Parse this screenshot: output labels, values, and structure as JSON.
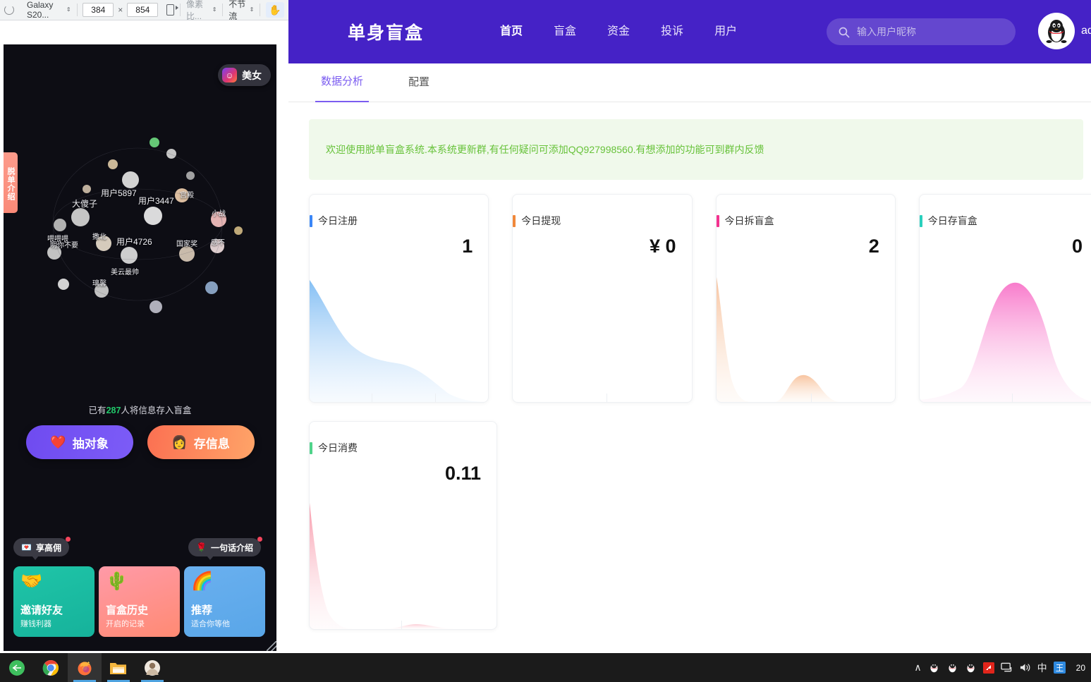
{
  "devtools": {
    "device_name": "Galaxy S20...",
    "width": "384",
    "height": "854",
    "rotate_icon": "rotate-icon",
    "dpr_label": "像素比...",
    "throttle_label": "不节流",
    "x_label": "×",
    "hand_icon": "touch-hand-icon"
  },
  "phone": {
    "badge_button": "美女",
    "badge_icon": "smiley-gradient-icon",
    "side_tab": "脱单介绍",
    "count_prefix": "已有",
    "count_number": "287",
    "count_suffix": "人将信息存入盲盒",
    "cta": [
      {
        "label": "抽对象",
        "emoji": "❤️",
        "color": "#7050f2"
      },
      {
        "label": "存信息",
        "emoji": "👩",
        "color": "#fb7d5b"
      }
    ],
    "tips": [
      {
        "label": "享高佣",
        "emoji": "💌"
      },
      {
        "label": "一句话介绍",
        "emoji": "🌹"
      }
    ],
    "features": [
      {
        "title": "邀请好友",
        "sub": "赚钱利器",
        "emoji": "🤝",
        "color": "#1ac0a6"
      },
      {
        "title": "盲盒历史",
        "sub": "开启的记录",
        "emoji": "🌵",
        "color": "#ff92a0"
      },
      {
        "title": "推荐",
        "sub": "适合你等他",
        "emoji": "🌈",
        "color": "#64abec"
      }
    ],
    "sphere_names": [
      "用户5897",
      "用户3447",
      "用户4726",
      "大傻子",
      "小战",
      "宫殿",
      "喂喂喂",
      "撒北",
      "美云最帅",
      "国家奖",
      "明你不要",
      "感不",
      "璃馨"
    ]
  },
  "header": {
    "brand": "单身盲盒",
    "nav": [
      {
        "label": "首页",
        "active": true
      },
      {
        "label": "盲盒",
        "active": false
      },
      {
        "label": "资金",
        "active": false
      },
      {
        "label": "投诉",
        "active": false
      },
      {
        "label": "用户",
        "active": false
      }
    ],
    "search_placeholder": "输入用户昵称",
    "search_value": "",
    "search_icon": "search-icon",
    "avatar_icon": "qq-penguin-avatar",
    "username": "ad",
    "bg_color": "#4522c6"
  },
  "tabs": [
    {
      "label": "数据分析",
      "active": true
    },
    {
      "label": "配置",
      "active": false
    }
  ],
  "banner": {
    "text": "欢迎使用脱单盲盒系统.本系统更新群,有任何疑问可添加QQ927998560.有想添加的功能可到群内反馈",
    "text_color": "#67c23a",
    "bg_color": "#f0f9eb"
  },
  "stat_cards": [
    {
      "title": "今日注册",
      "value": "1",
      "accent": "#3a86f7",
      "spark_color": "#8dc4f7",
      "shape": "decay"
    },
    {
      "title": "今日提现",
      "value": "¥ 0",
      "accent": "#f0883a",
      "spark_color": "#f7c79a",
      "shape": "flat"
    },
    {
      "title": "今日拆盲盒",
      "value": "2",
      "accent": "#f4338f",
      "spark_color": "#f6bb8e",
      "shape": "twin"
    },
    {
      "title": "今日存盲盒",
      "value": "0",
      "accent": "#2ad0bd",
      "spark_color": "#f78ad4",
      "shape": "bell"
    },
    {
      "title": "今日消费",
      "value": "0.11",
      "accent": "#4fd38a",
      "spark_color": "#f78fa0",
      "shape": "spike"
    }
  ],
  "taskbar": {
    "icons": [
      {
        "name": "start-green-icon",
        "glyph": "◐",
        "color": "#3ebf5e"
      },
      {
        "name": "chrome-icon",
        "glyph": "",
        "color": "#4285f4"
      },
      {
        "name": "firefox-icon",
        "glyph": "",
        "color": "#ff7139"
      },
      {
        "name": "file-explorer-icon",
        "glyph": "",
        "color": "#f9c23c"
      },
      {
        "name": "photos-icon",
        "glyph": "",
        "color": "#c9b29b"
      }
    ],
    "tray": [
      {
        "name": "chevron-up-icon",
        "glyph": "∧"
      },
      {
        "name": "qq-icon",
        "glyph": "🐧"
      },
      {
        "name": "qq-icon",
        "glyph": "🐧"
      },
      {
        "name": "qq-icon",
        "glyph": "🐧"
      },
      {
        "name": "red-app-icon",
        "glyph": "◤"
      },
      {
        "name": "network-icon",
        "glyph": ""
      },
      {
        "name": "volume-icon",
        "glyph": ""
      },
      {
        "name": "ime-chinese-icon",
        "glyph": "中"
      },
      {
        "name": "wangyi-icon",
        "glyph": "王"
      }
    ],
    "clock": "20"
  }
}
